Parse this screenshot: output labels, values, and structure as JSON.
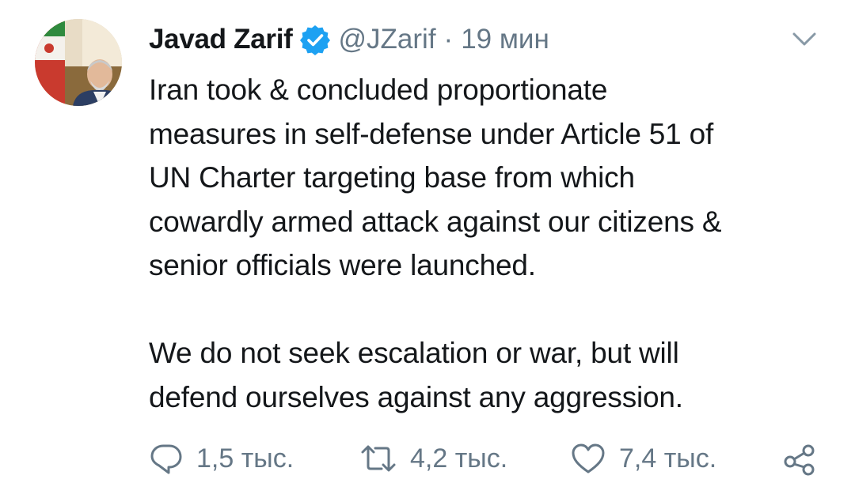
{
  "tweet": {
    "author": {
      "display_name": "Javad Zarif",
      "handle": "@JZarif",
      "verified": true,
      "avatar_icon": "profile-photo"
    },
    "separator": "·",
    "time": "19 мин",
    "menu_icon": "chevron-down-icon",
    "body": {
      "paragraph_1": "Iran took & concluded proportionate measures in self-defense under Article 51 of UN Charter targeting base from which cowardly armed attack against our citizens & senior officials were launched.",
      "paragraph_1_lines": [
        "Iran took & concluded proportionate",
        "measures in self-defense under Article 51 of",
        "UN Charter targeting base from which",
        "cowardly armed attack against our citizens &",
        "senior officials were launched."
      ],
      "paragraph_2_lines": [
        "We do not seek escalation or war, but will",
        "defend ourselves against any aggression."
      ]
    },
    "actions": {
      "reply": {
        "icon": "reply-icon",
        "count": "1,5 тыс."
      },
      "retweet": {
        "icon": "retweet-icon",
        "count": "4,2 тыс."
      },
      "like": {
        "icon": "heart-icon",
        "count": "7,4 тыс."
      },
      "share": {
        "icon": "share-icon"
      }
    }
  },
  "colors": {
    "text": "#14171a",
    "secondary": "#657786",
    "verified_blue": "#1da1f2",
    "background": "#ffffff"
  }
}
